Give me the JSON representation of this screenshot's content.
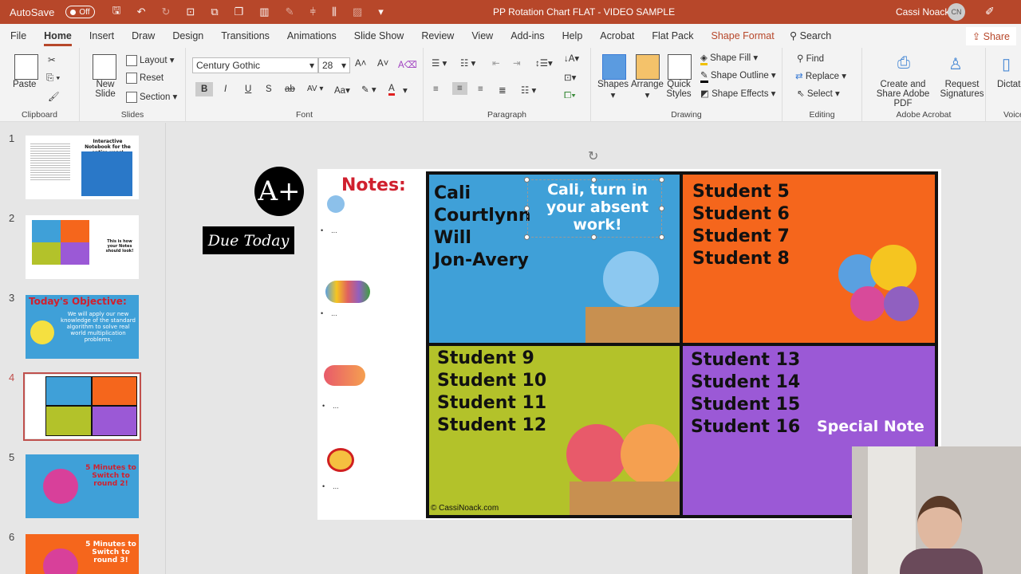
{
  "titlebar": {
    "autosave_label": "AutoSave",
    "autosave_state": "Off",
    "title": "PP Rotation Chart FLAT - VIDEO SAMPLE",
    "user_name": "Cassi Noack",
    "user_initials": "CN"
  },
  "tabs": [
    {
      "label": "File"
    },
    {
      "label": "Home",
      "active": true
    },
    {
      "label": "Insert"
    },
    {
      "label": "Draw"
    },
    {
      "label": "Design"
    },
    {
      "label": "Transitions"
    },
    {
      "label": "Animations"
    },
    {
      "label": "Slide Show"
    },
    {
      "label": "Review"
    },
    {
      "label": "View"
    },
    {
      "label": "Add-ins"
    },
    {
      "label": "Help"
    },
    {
      "label": "Acrobat"
    },
    {
      "label": "Flat Pack"
    },
    {
      "label": "Shape Format",
      "contextual": true
    }
  ],
  "search_label": "Search",
  "share_label": "Share",
  "ribbon": {
    "clipboard": {
      "label": "Clipboard",
      "paste": "Paste"
    },
    "slides": {
      "label": "Slides",
      "new_slide": "New Slide",
      "layout": "Layout",
      "reset": "Reset",
      "section": "Section"
    },
    "font": {
      "label": "Font",
      "font_name": "Century Gothic",
      "font_size": "28",
      "bold": "B",
      "italic": "I",
      "underline": "U",
      "shadow": "S",
      "strike": "ab",
      "spacing": "AV",
      "case": "Aa"
    },
    "paragraph": {
      "label": "Paragraph"
    },
    "drawing": {
      "label": "Drawing",
      "shapes": "Shapes",
      "arrange": "Arrange",
      "quick_styles": "Quick Styles",
      "shape_fill": "Shape Fill",
      "shape_outline": "Shape Outline",
      "shape_effects": "Shape Effects"
    },
    "editing": {
      "label": "Editing",
      "find": "Find",
      "replace": "Replace",
      "select": "Select"
    },
    "acrobat": {
      "label": "Adobe Acrobat",
      "create_share": "Create and Share Adobe PDF",
      "request_sig": "Request Signatures"
    },
    "voice": {
      "label": "Voice",
      "dictate": "Dictate"
    }
  },
  "thumbnails": [
    {
      "num": "1",
      "text": "Interactive Notebook for the entire year!"
    },
    {
      "num": "2",
      "text": "This is how your Notes should look!"
    },
    {
      "num": "3",
      "title": "Today's Objective:",
      "text": "We will apply our new knowledge of the standard algorithm to solve real world multiplication problems."
    },
    {
      "num": "4",
      "selected": true
    },
    {
      "num": "5",
      "text": "5 Minutes to Switch to round 2!"
    },
    {
      "num": "6",
      "text": "5 Minutes to Switch to round 3!"
    }
  ],
  "slide": {
    "aplus": "A+",
    "due_today": "Due Today",
    "notes_title": "Notes:",
    "notes_bullets": [
      "...",
      "...",
      "...",
      "..."
    ],
    "quadrants": [
      {
        "color": "#3fa0d8",
        "names": [
          "Cali",
          "Courtlynn",
          "Will",
          "Jon-Avery"
        ],
        "note": "Cali, turn in your absent work!"
      },
      {
        "color": "#f5661c",
        "names": [
          "Student 5",
          "Student 6",
          "Student 7",
          "Student 8"
        ]
      },
      {
        "color": "#b3c22a",
        "names": [
          "Student 9",
          "Student 10",
          "Student 11",
          "Student 12"
        ]
      },
      {
        "color": "#9b59d6",
        "names": [
          "Student 13",
          "Student 14",
          "Student 15",
          "Student 16"
        ],
        "note": "Special Note"
      }
    ],
    "copyright": "© CassiNoack.com"
  },
  "colors": {
    "accent": "#b7472a",
    "notes_red": "#d0202e"
  }
}
